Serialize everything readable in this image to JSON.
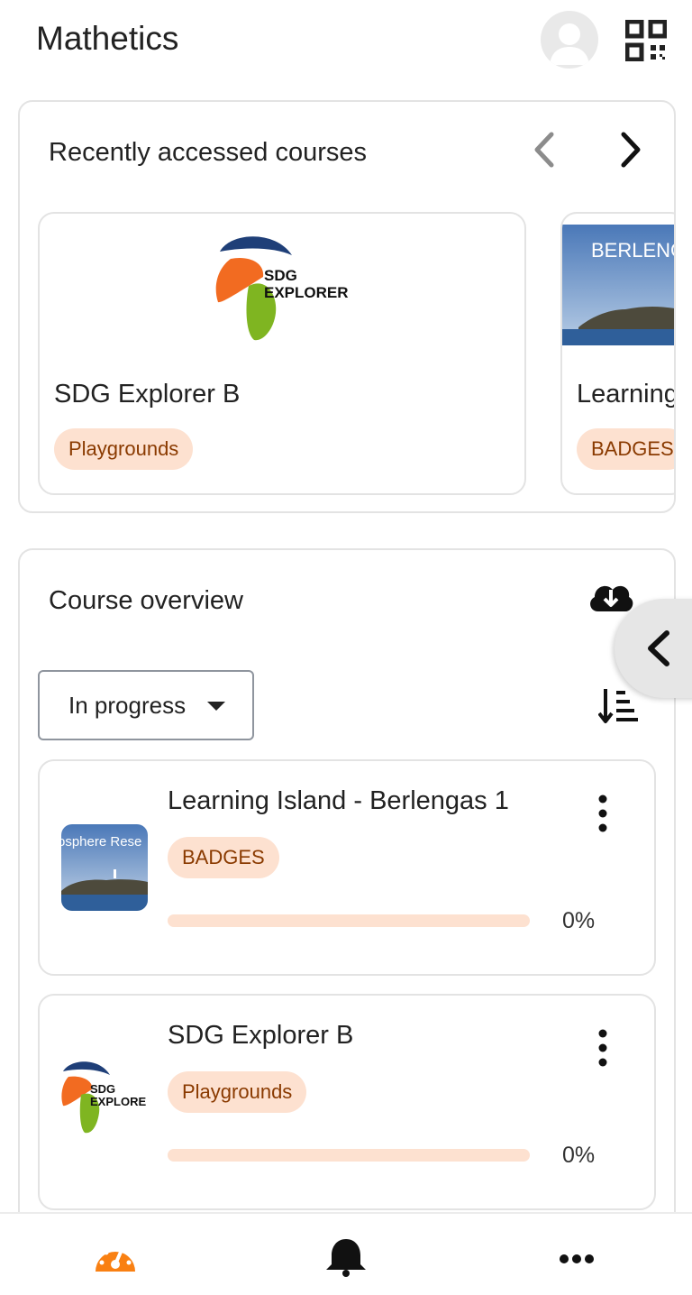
{
  "header": {
    "title": "Mathetics",
    "avatar_icon": "user-avatar-icon",
    "qr_icon": "qr-code-icon"
  },
  "recent": {
    "title": "Recently accessed courses",
    "prev_icon": "chevron-left-icon",
    "next_icon": "chevron-right-icon",
    "courses": [
      {
        "name": "SDG Explorer B",
        "category": "Playgrounds",
        "logo_text": [
          "SDG",
          "EXPLORER"
        ]
      },
      {
        "name": "Learning",
        "category": "BADGES",
        "image_text": "BERLENG"
      }
    ]
  },
  "overview": {
    "title": "Course overview",
    "download_icon": "cloud-download-icon",
    "filter_value": "In progress",
    "sort_icon": "sort-icon",
    "courses": [
      {
        "name": "Learning Island - Berlengas 1",
        "category": "BADGES",
        "progress": 0,
        "progress_text": "0%",
        "image_text": "osphere Rese"
      },
      {
        "name": "SDG Explorer B",
        "category": "Playgrounds",
        "progress": 0,
        "progress_text": "0%",
        "logo_text": [
          "SDG",
          "EXPLORE"
        ]
      }
    ]
  },
  "drawer_icon": "chevron-left-icon",
  "bottom_nav": {
    "items": [
      "dashboard-icon",
      "notifications-bell-icon",
      "more-icon"
    ]
  },
  "colors": {
    "accent": "#f98012",
    "badge_bg": "#fde1d0",
    "badge_text": "#8a3a00",
    "border": "#e3e3e3"
  }
}
